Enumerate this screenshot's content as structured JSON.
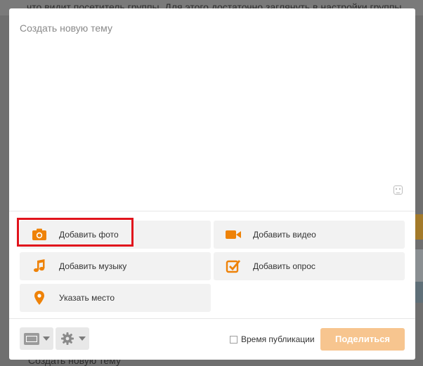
{
  "background_page": {
    "top_text": "что видит посетитель группы. Для этого достаточно заглянуть в настройки группы",
    "bottom_text": "Создать новую тему"
  },
  "dialog": {
    "compose_placeholder": "Создать новую тему",
    "attachments": {
      "photo": "Добавить фото",
      "video": "Добавить видео",
      "music": "Добавить музыку",
      "poll": "Добавить опрос",
      "place": "Указать место"
    },
    "footer": {
      "publish_time_label": "Время публикации",
      "publish_time_checked": false,
      "share_label": "Поделиться"
    }
  },
  "colors": {
    "accent": "#ee8208",
    "highlight": "#e1141c",
    "share_disabled": "#f7c58f"
  },
  "icons": {
    "photo": "camera-icon",
    "video": "video-camera-icon",
    "music": "music-note-icon",
    "poll": "poll-checkbox-icon",
    "place": "location-pin-icon",
    "layout": "layout-icon",
    "settings": "gear-icon",
    "emoji": "smiley-icon"
  }
}
